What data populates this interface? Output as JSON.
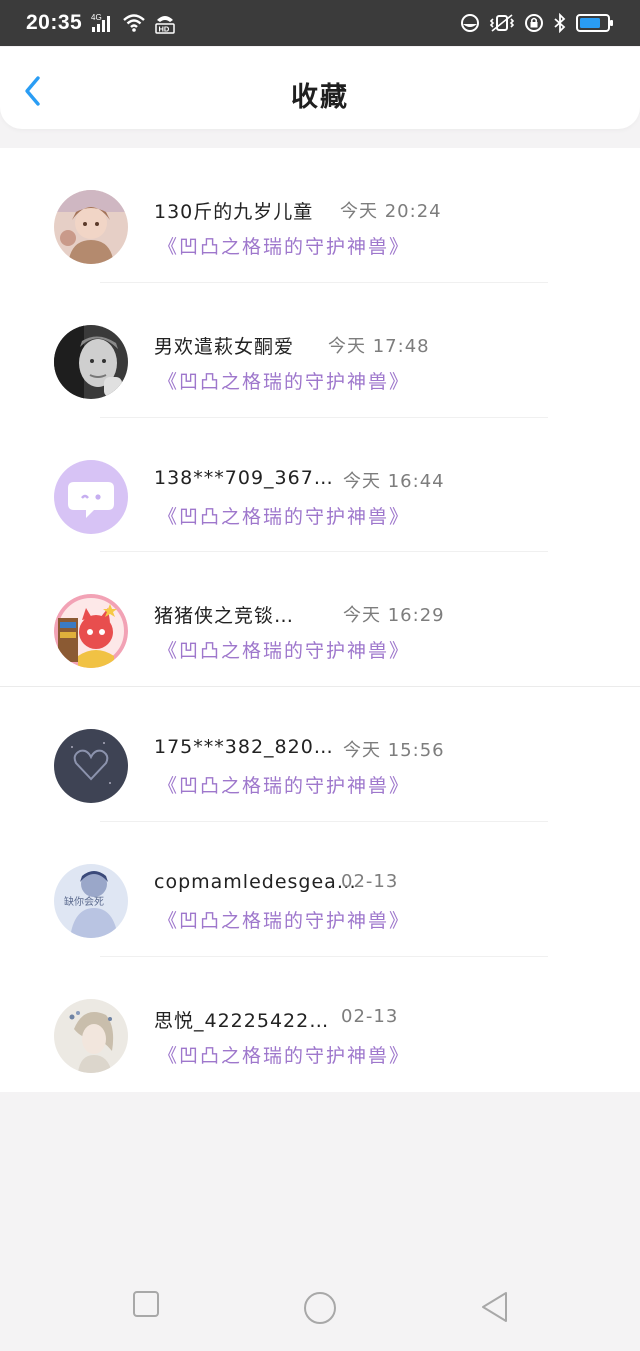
{
  "status_bar": {
    "time": "20:35",
    "network": "4G",
    "hd": "HD"
  },
  "header": {
    "title": "收藏"
  },
  "items": [
    {
      "name": "130斤的九岁儿童",
      "time": "今天 20:24",
      "work": "《凹凸之格瑞的守护神兽》"
    },
    {
      "name": "男欢遣萩女酮爱",
      "time": "今天 17:48",
      "work": "《凹凸之格瑞的守护神兽》"
    },
    {
      "name": "138***709_367…",
      "time": "今天 16:44",
      "work": "《凹凸之格瑞的守护神兽》"
    },
    {
      "name": "猪猪侠之竞锬…",
      "time": "今天 16:29",
      "work": "《凹凸之格瑞的守护神兽》"
    },
    {
      "name": "175***382_820…",
      "time": "今天 15:56",
      "work": "《凹凸之格瑞的守护神兽》"
    },
    {
      "name": "copmamledesgea…",
      "time": "02-13",
      "work": "《凹凸之格瑞的守护神兽》",
      "avatar_text": "缺你会死"
    },
    {
      "name": "思悦_42225422…",
      "time": "02-13",
      "work": "《凹凸之格瑞的守护神兽》"
    }
  ],
  "colors": {
    "accent_blue": "#2a9df4",
    "work_purple": "#9e77cc",
    "status_bar": "#3b3b3b",
    "page_bg": "#f4f3f4"
  },
  "icons": [
    "back-arrow-icon",
    "nav-recent-square-icon",
    "nav-home-circle-icon",
    "nav-back-triangle-icon"
  ]
}
